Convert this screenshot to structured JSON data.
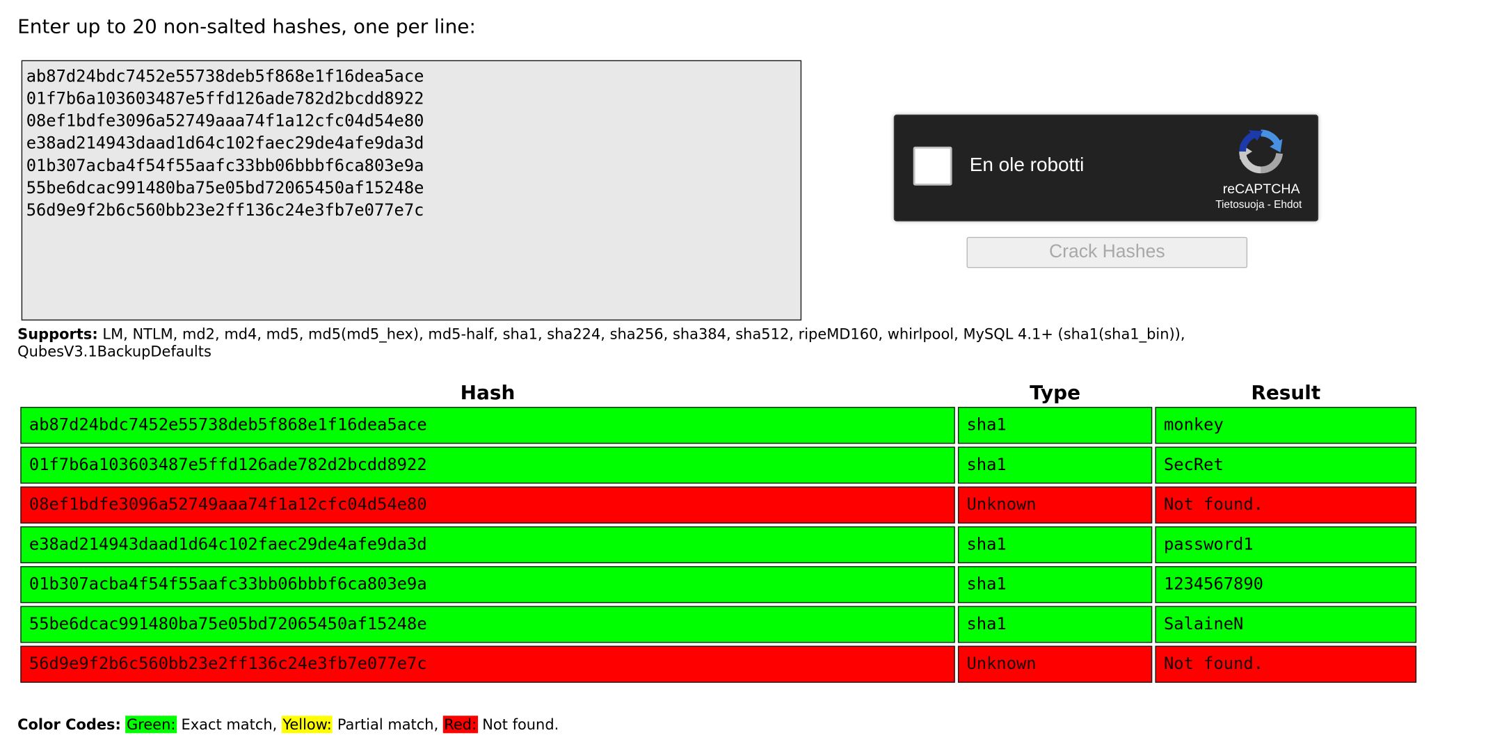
{
  "form": {
    "instructions": "Enter up to 20 non-salted hashes, one per line:",
    "hashes_text": "ab87d24bdc7452e55738deb5f868e1f16dea5ace\n01f7b6a103603487e5ffd126ade782d2bcdd8922\n08ef1bdfe3096a52749aaa74f1a12cfc04d54e80\ne38ad214943daad1d64c102faec29de4afe9da3d\n01b307acba4f54f55aafc33bb06bbbf6ca803e9a\n55be6dcac991480ba75e05bd72065450af15248e\n56d9e9f2b6c560bb23e2ff136c24e3fb7e077e7c",
    "submit_label": "Crack Hashes"
  },
  "recaptcha": {
    "label": "En ole robotti",
    "brand": "reCAPTCHA",
    "privacy_link": "Tietosuoja",
    "separator": " - ",
    "terms_link": "Ehdot",
    "checked": false
  },
  "supports": {
    "label": "Supports:",
    "text": "LM, NTLM, md2, md4, md5, md5(md5_hex), md5-half, sha1, sha224, sha256, sha384, sha512, ripeMD160, whirlpool, MySQL 4.1+ (sha1(sha1_bin)), QubesV3.1BackupDefaults"
  },
  "results": {
    "headers": {
      "hash": "Hash",
      "type": "Type",
      "result": "Result"
    },
    "rows": [
      {
        "hash": "ab87d24bdc7452e55738deb5f868e1f16dea5ace",
        "type": "sha1",
        "result": "monkey",
        "status": "found"
      },
      {
        "hash": "01f7b6a103603487e5ffd126ade782d2bcdd8922",
        "type": "sha1",
        "result": "SecRet",
        "status": "found"
      },
      {
        "hash": "08ef1bdfe3096a52749aaa74f1a12cfc04d54e80",
        "type": "Unknown",
        "result": "Not found.",
        "status": "notfound"
      },
      {
        "hash": "e38ad214943daad1d64c102faec29de4afe9da3d",
        "type": "sha1",
        "result": "password1",
        "status": "found"
      },
      {
        "hash": "01b307acba4f54f55aafc33bb06bbbf6ca803e9a",
        "type": "sha1",
        "result": "1234567890",
        "status": "found"
      },
      {
        "hash": "55be6dcac991480ba75e05bd72065450af15248e",
        "type": "sha1",
        "result": "SalaineN",
        "status": "found"
      },
      {
        "hash": "56d9e9f2b6c560bb23e2ff136c24e3fb7e077e7c",
        "type": "Unknown",
        "result": "Not found.",
        "status": "notfound"
      }
    ]
  },
  "legend": {
    "label": "Color Codes:",
    "green_label": "Green:",
    "green_text": " Exact match, ",
    "yellow_label": "Yellow:",
    "yellow_text": " Partial match, ",
    "red_label": "Red:",
    "red_text": " Not found.",
    "colors": {
      "green": "#00ff00",
      "yellow": "#ffff00",
      "red": "#ff0000"
    }
  }
}
